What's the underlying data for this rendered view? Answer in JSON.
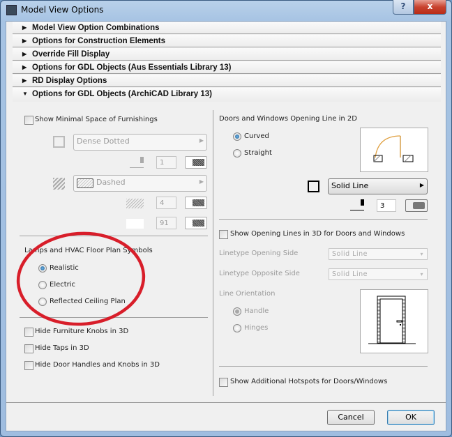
{
  "window": {
    "title": "Model View Options",
    "help_label": "?",
    "close_label": "x"
  },
  "accordion": [
    {
      "label": "Model View Option Combinations",
      "expanded": false
    },
    {
      "label": "Options for Construction Elements",
      "expanded": false
    },
    {
      "label": "Override Fill Display",
      "expanded": false
    },
    {
      "label": "Options for GDL Objects (Aus Essentials Library 13)",
      "expanded": false
    },
    {
      "label": "RD Display Options",
      "expanded": false
    },
    {
      "label": "Options for GDL Objects (ArchiCAD Library 13)",
      "expanded": true
    }
  ],
  "icons": {
    "collapsed": "▶",
    "expanded": "▼",
    "dropdown": "▶",
    "select": "▾"
  },
  "left": {
    "minimal_space": {
      "label": "Show Minimal Space of Furnishings",
      "checked": false
    },
    "line_type": "Dense Dotted",
    "line_pen": "1",
    "fill_type": "Dashed",
    "fill_pen": "4",
    "bg_pen": "91",
    "lamps": {
      "label": "Lamps and HVAC Floor Plan Symbols",
      "options": [
        "Realistic",
        "Electric",
        "Reflected Ceiling Plan"
      ],
      "selected": "Realistic"
    },
    "checks": [
      {
        "label": "Hide Furniture Knobs in 3D",
        "checked": false
      },
      {
        "label": "Hide Taps in 3D",
        "checked": false
      },
      {
        "label": "Hide Door Handles and Knobs in 3D",
        "checked": false
      }
    ]
  },
  "right": {
    "opening_label": "Doors and Windows Opening Line in 2D",
    "opening_options": [
      "Curved",
      "Straight"
    ],
    "opening_selected": "Curved",
    "line_type": "Solid Line",
    "pen": "3",
    "show_3d": {
      "label": "Show Opening Lines in 3D for Doors and Windows",
      "checked": false
    },
    "linetype_opening": {
      "label": "Linetype Opening Side",
      "value": "Solid Line"
    },
    "linetype_opposite": {
      "label": "Linetype Opposite Side",
      "value": "Solid Line"
    },
    "orientation": {
      "label": "Line Orientation",
      "options": [
        "Handle",
        "Hinges"
      ],
      "selected": "Handle"
    },
    "hotspots": {
      "label": "Show Additional Hotspots for Doors/Windows",
      "checked": false
    }
  },
  "footer": {
    "cancel": "Cancel",
    "ok": "OK"
  },
  "annotation_color": "#d81e2a"
}
